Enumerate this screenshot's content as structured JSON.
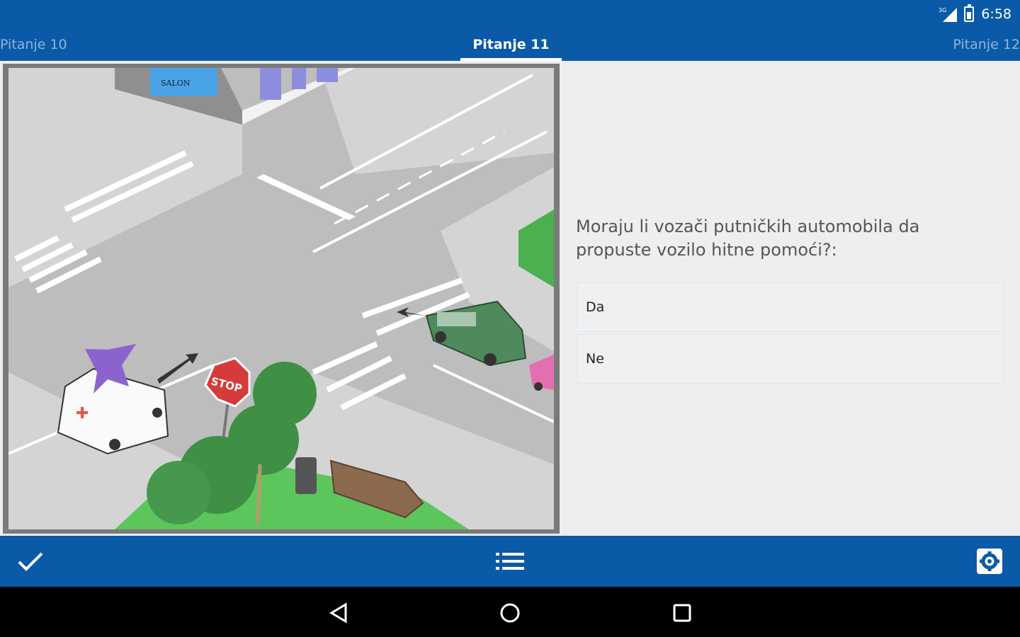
{
  "status_bar": {
    "network": "3G",
    "time": "6:58"
  },
  "tabs": {
    "previous": "Pitanje 10",
    "current": "Pitanje 11",
    "next": "Pitanje 12"
  },
  "figure": {
    "stop_sign_text": "STOP",
    "shop_sign_text": "SALON"
  },
  "question": {
    "text": "Moraju li vozači putničkih automobila da propuste vozilo hitne pomoći?:",
    "answers": [
      {
        "label": "Da"
      },
      {
        "label": "Ne"
      }
    ]
  },
  "toolbar": {
    "icons": [
      "check-icon",
      "list-icon",
      "settings-icon"
    ]
  },
  "navigation_bar": {
    "icons": [
      "back-icon",
      "home-icon",
      "recent-apps-icon"
    ]
  },
  "colors": {
    "primary": "#0a5aa8",
    "background": "#eeeeee",
    "nav_bar": "#000000"
  }
}
